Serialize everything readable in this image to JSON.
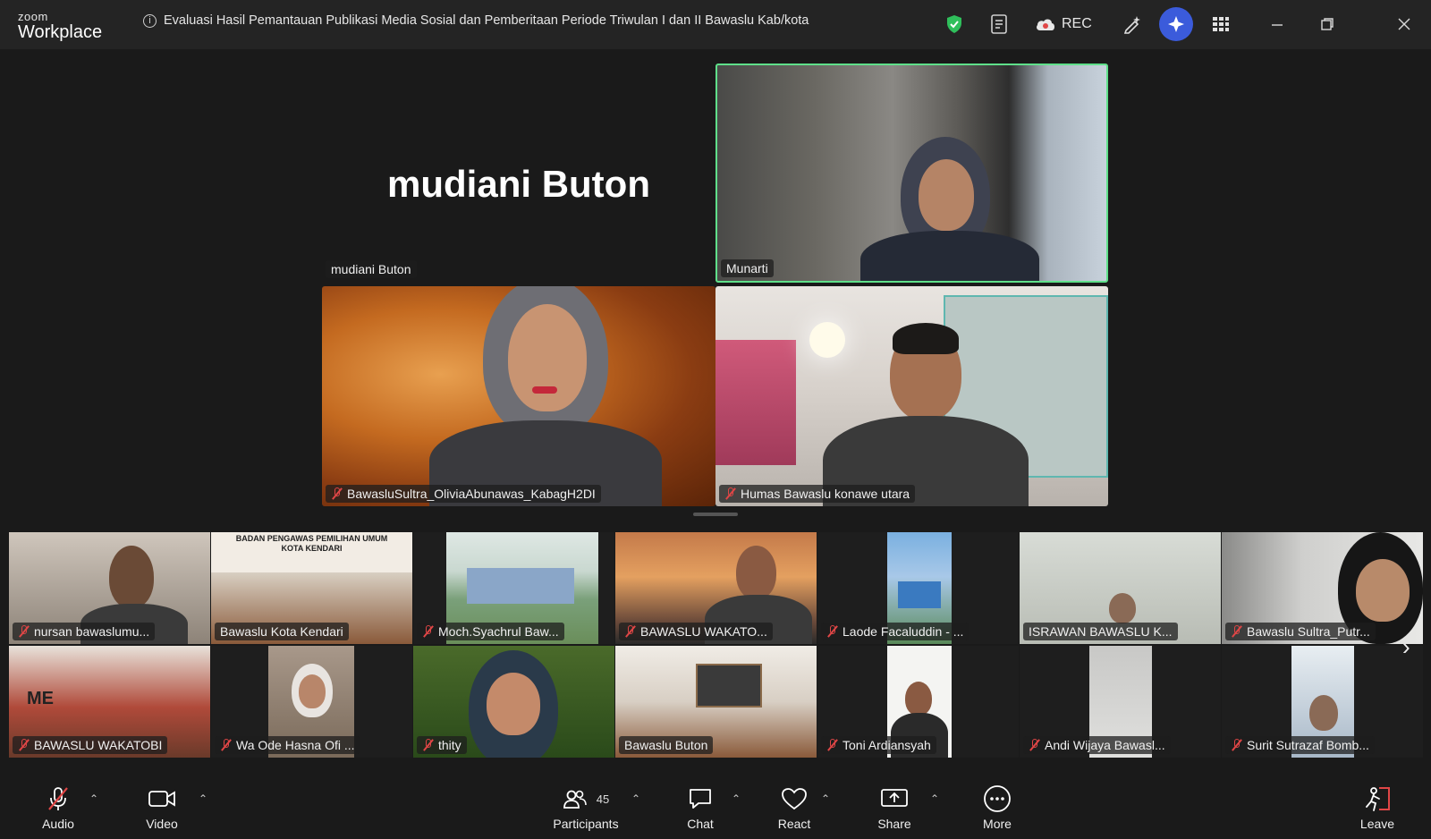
{
  "app": {
    "brand_top": "zoom",
    "brand_bottom": "Workplace"
  },
  "meeting": {
    "title": "Evaluasi Hasil Pemantauan Publikasi Media Sosial dan Pemberitaan Periode Triwulan I dan II Bawaslu Kab/kota"
  },
  "titlebar": {
    "rec_label": "REC"
  },
  "colors": {
    "active_speaker": "#5fe08a",
    "mute": "#e04646",
    "accent": "#3b5bdb"
  },
  "gallery": {
    "big_name": "mudiani Buton",
    "tiles": [
      {
        "name": "mudiani Buton",
        "muted": false
      },
      {
        "name": "Munarti",
        "muted": false
      },
      {
        "name": "BawasluSultra_OliviaAbunawas_KabagH2DI",
        "muted": true
      },
      {
        "name": "Humas Bawaslu konawe utara",
        "muted": true
      }
    ]
  },
  "filmstrip": {
    "banner_text": "BADAN PENGAWAS PEMILIHAN UMUM\nKOTA KENDARI",
    "participants": [
      {
        "name": "nursan bawaslumu...",
        "muted": true
      },
      {
        "name": "Bawaslu Kota Kendari",
        "muted": false
      },
      {
        "name": "Moch.Syachrul Baw...",
        "muted": true
      },
      {
        "name": "BAWASLU WAKATO...",
        "muted": true
      },
      {
        "name": "Laode Facaluddin - ...",
        "muted": true
      },
      {
        "name": "ISRAWAN BAWASLU K...",
        "muted": false
      },
      {
        "name": "Bawaslu Sultra_Putr...",
        "muted": true
      },
      {
        "name": "BAWASLU WAKATOBI",
        "muted": true
      },
      {
        "name": "Wa Ode Hasna Ofi ...",
        "muted": true
      },
      {
        "name": "thity",
        "muted": true
      },
      {
        "name": "Bawaslu Buton",
        "muted": false
      },
      {
        "name": "Toni Ardiansyah",
        "muted": true
      },
      {
        "name": "Andi Wijaya Bawasl...",
        "muted": true
      },
      {
        "name": "Surit Sutrazaf Bomb...",
        "muted": true
      }
    ]
  },
  "toolbar": {
    "audio": "Audio",
    "video": "Video",
    "participants": "Participants",
    "participant_count": "45",
    "chat": "Chat",
    "react": "React",
    "share": "Share",
    "more": "More",
    "leave": "Leave"
  }
}
